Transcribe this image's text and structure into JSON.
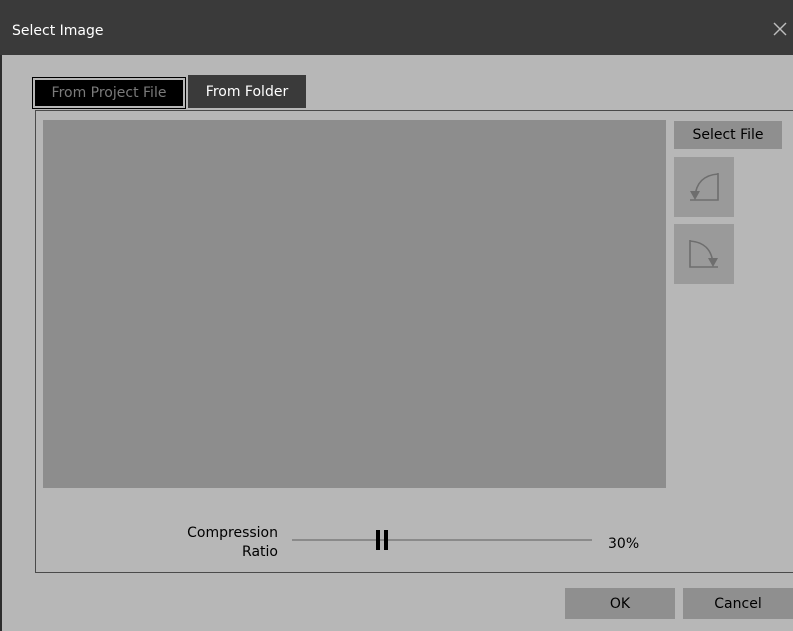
{
  "dialog": {
    "title": "Select Image",
    "close_icon": "close-icon"
  },
  "tabs": [
    {
      "label": "From Project File",
      "active": false
    },
    {
      "label": "From Folder",
      "active": true
    }
  ],
  "side_panel": {
    "select_file_label": "Select File",
    "rotate_left_icon": "rotate-left-icon",
    "rotate_right_icon": "rotate-right-icon"
  },
  "compression": {
    "label_line1": "Compression",
    "label_line2": "Ratio",
    "value": 0.3,
    "value_text": "30%"
  },
  "footer": {
    "ok_label": "OK",
    "cancel_label": "Cancel"
  },
  "colors": {
    "titlebar": "#3a3a3a",
    "dialog_bg": "#b7b7b7",
    "preview_bg": "#8d8d8d",
    "button_bg": "#8f8f8f"
  }
}
